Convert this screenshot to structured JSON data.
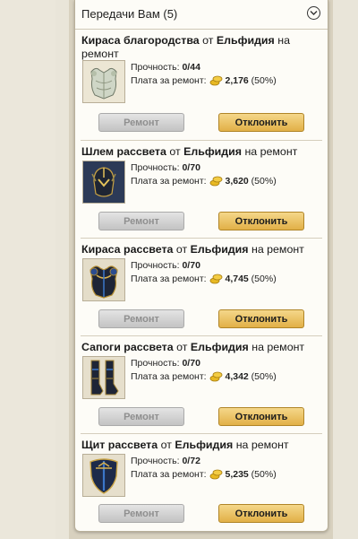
{
  "panel": {
    "title": "Передачи Вам (5)"
  },
  "cards": [
    {
      "item": "Кираса благородства",
      "from_word": " от ",
      "sender": "Ельфидия",
      "suffix": " на ремонт",
      "durability_label": "Прочность: ",
      "durability": "0/44",
      "fee_label": "Плата за ремонт: ",
      "fee": "2,176",
      "percent": " (50%)",
      "repair_label": "Ремонт",
      "decline_label": "Отклонить",
      "icon": "breastplate-icon"
    },
    {
      "item": "Шлем рассвета",
      "from_word": " от ",
      "sender": "Ельфидия",
      "suffix": " на ремонт",
      "durability_label": "Прочность: ",
      "durability": "0/70",
      "fee_label": "Плата за ремонт: ",
      "fee": "3,620",
      "percent": " (50%)",
      "repair_label": "Ремонт",
      "decline_label": "Отклонить",
      "icon": "helmet-icon"
    },
    {
      "item": "Кираса рассвета",
      "from_word": " от ",
      "sender": "Ельфидия",
      "suffix": " на ремонт",
      "durability_label": "Прочность: ",
      "durability": "0/70",
      "fee_label": "Плата за ремонт: ",
      "fee": "4,745",
      "percent": " (50%)",
      "repair_label": "Ремонт",
      "decline_label": "Отклонить",
      "icon": "cuirass-icon"
    },
    {
      "item": "Сапоги рассвета",
      "from_word": " от ",
      "sender": "Ельфидия",
      "suffix": " на ремонт",
      "durability_label": "Прочность: ",
      "durability": "0/70",
      "fee_label": "Плата за ремонт: ",
      "fee": "4,342",
      "percent": " (50%)",
      "repair_label": "Ремонт",
      "decline_label": "Отклонить",
      "icon": "boots-icon"
    },
    {
      "item": "Щит рассвета",
      "from_word": " от ",
      "sender": "Ельфидия",
      "suffix": " на ремонт",
      "durability_label": "Прочность: ",
      "durability": "0/72",
      "fee_label": "Плата за ремонт: ",
      "fee": "5,235",
      "percent": " (50%)",
      "repair_label": "Ремонт",
      "decline_label": "Отклонить",
      "icon": "shield-icon"
    }
  ],
  "colors": {
    "decline_button": "#e2b047",
    "repair_button_disabled": "#c3c3c3",
    "gold_coin": "#e8b923"
  }
}
